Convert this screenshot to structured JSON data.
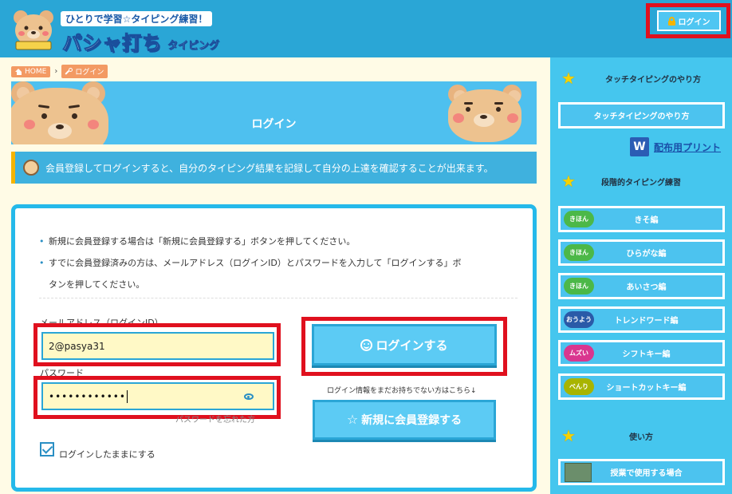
{
  "header": {
    "tagline": "ひとりで学習☆タイピング練習！",
    "title": "パシャ打ち",
    "title_sub": "タイピング",
    "login_button": "ログイン"
  },
  "breadcrumb": {
    "home": "HOME",
    "current": "ログイン"
  },
  "banner": {
    "title": "ログイン"
  },
  "info": {
    "text": "会員登録してログインすると、自分のタイピング結果を記録して自分の上達を確認することが出来ます。"
  },
  "notes": [
    "新規に会員登録する場合は「新規に会員登録する」ボタンを押してください。",
    "すでに会員登録済みの方は、メールアドレス（ログインID）とパスワードを入力して「ログインする」ボ",
    "タンを押してください。"
  ],
  "form": {
    "email_label": "メールアドレス（ログインID）",
    "email_value": "2@pasya31",
    "password_label": "パスワード",
    "password_value": "••••••••••••",
    "forgot": "パスワードを忘れた方",
    "remember_label": "ログインしたままにする",
    "login_button": "ログインする",
    "no_account": "ログイン情報をまだお持ちでない方はこちら↓",
    "register_button": "新規に会員登録する"
  },
  "sidebar": {
    "section1_title": "タッチタイピングのやり方",
    "touch_button": "タッチタイピングのやり方",
    "print_link": "配布用プリント",
    "section2_title": "段階的タイピング練習",
    "items": [
      {
        "badge": "きほん",
        "label": "きそ編",
        "color": "#4cb848"
      },
      {
        "badge": "きほん",
        "label": "ひらがな編",
        "color": "#4cb848"
      },
      {
        "badge": "きほん",
        "label": "あいさつ編",
        "color": "#4cb848"
      },
      {
        "badge": "おうよう",
        "label": "トレンドワード編",
        "color": "#2a5aa8"
      },
      {
        "badge": "ムズい",
        "label": "シフトキー編",
        "color": "#d9368f"
      },
      {
        "badge": "べんり",
        "label": "ショートカットキー編",
        "color": "#a8b400"
      }
    ],
    "section3_title": "使い方",
    "usage_button": "授業で使用する場合"
  }
}
